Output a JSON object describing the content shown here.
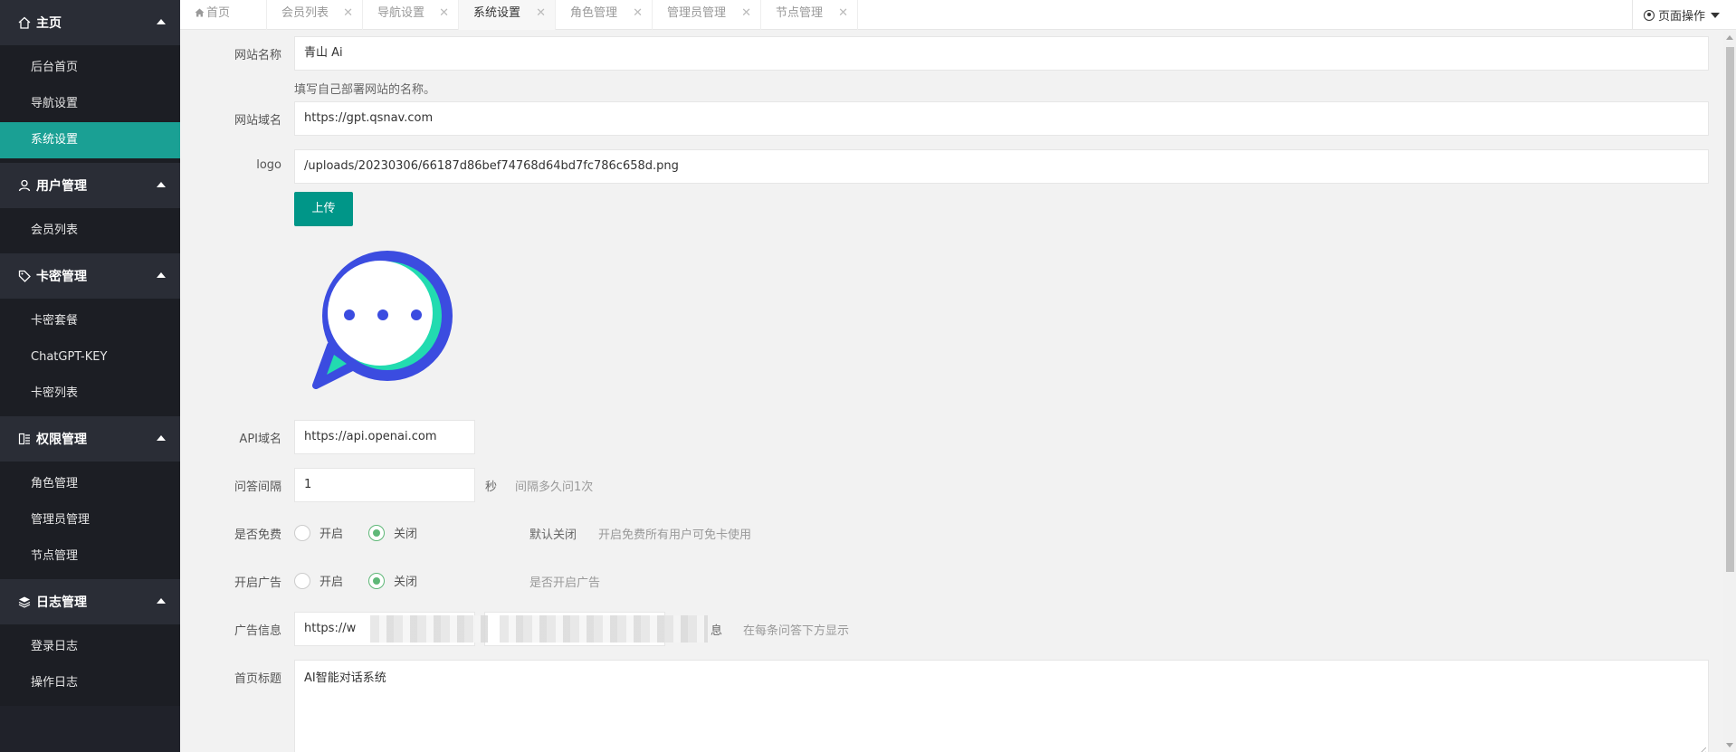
{
  "sidebar": {
    "groups": [
      {
        "title": "主页",
        "icon": "home-icon",
        "items": [
          "后台首页",
          "导航设置",
          "系统设置"
        ]
      },
      {
        "title": "用户管理",
        "icon": "user-icon",
        "items": [
          "会员列表"
        ]
      },
      {
        "title": "卡密管理",
        "icon": "tag-icon",
        "items": [
          "卡密套餐",
          "ChatGPT-KEY",
          "卡密列表"
        ]
      },
      {
        "title": "权限管理",
        "icon": "permission-icon",
        "items": [
          "角色管理",
          "管理员管理",
          "节点管理"
        ]
      },
      {
        "title": "日志管理",
        "icon": "layers-icon",
        "items": [
          "登录日志",
          "操作日志"
        ]
      }
    ],
    "active_item": "系统设置"
  },
  "tabs": [
    "首页",
    "会员列表",
    "导航设置",
    "系统设置",
    "角色管理",
    "管理员管理",
    "节点管理"
  ],
  "active_tab": "系统设置",
  "page_ops": "页面操作",
  "colors": {
    "accent": "#009688",
    "active_nav": "#1aa094",
    "sidebar_bg": "#20222a",
    "radio_checked": "#5fb878"
  },
  "form": {
    "site_name": {
      "label": "网站名称",
      "value": "青山 Ai",
      "hint": "填写自己部署网站的名称。"
    },
    "site_domain": {
      "label": "网站域名",
      "value": "https://gpt.qsnav.com"
    },
    "logo": {
      "label": "logo",
      "value": "/uploads/20230306/66187d86bef74768d64bd7fc786c658d.png",
      "upload_label": "上传"
    },
    "api_domain": {
      "label": "API域名",
      "value": "https://api.openai.com"
    },
    "interval": {
      "label": "问答间隔",
      "value": "1",
      "unit": "秒",
      "hint": "间隔多久问1次"
    },
    "free": {
      "label": "是否免费",
      "on_label": "开启",
      "off_label": "关闭",
      "selected": "关闭",
      "default_note": "默认关闭",
      "hint": "开启免费所有用户可免卡使用"
    },
    "ads": {
      "label": "开启广告",
      "on_label": "开启",
      "off_label": "关闭",
      "selected": "关闭",
      "hint": "是否开启广告"
    },
    "ad_info": {
      "label": "广告信息",
      "url_value": "https://w",
      "suffix": "息",
      "hint": "在每条问答下方显示"
    },
    "home_title": {
      "label": "首页标题",
      "value": "AI智能对话系统"
    }
  }
}
